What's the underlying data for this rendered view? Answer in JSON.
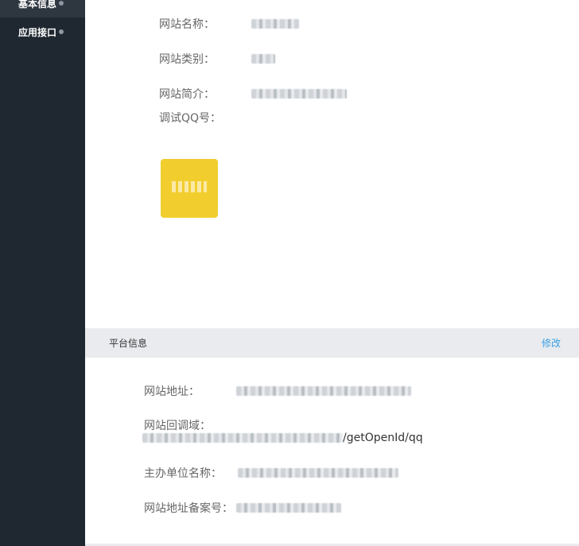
{
  "sidebar": {
    "items": [
      {
        "label": "基本信息"
      },
      {
        "label": "应用接口"
      }
    ]
  },
  "basic_info": {
    "site_name_label": "网站名称：",
    "site_type_label": "网站类别：",
    "site_intro_label": "网站简介：",
    "debug_qq_label": "调试QQ号："
  },
  "platform_info": {
    "title": "平台信息",
    "edit_label": "修改",
    "site_url_label": "网站地址：",
    "callback_label": "网站回调域：",
    "callback_suffix": "/getOpenId/qq",
    "organizer_label": "主办单位名称：",
    "icp_label": "网站地址备案号："
  },
  "colors": {
    "sidebar_bg": "#1f2730",
    "accent_link": "#3aa0e6",
    "section_header_bg": "#e9ebee"
  }
}
